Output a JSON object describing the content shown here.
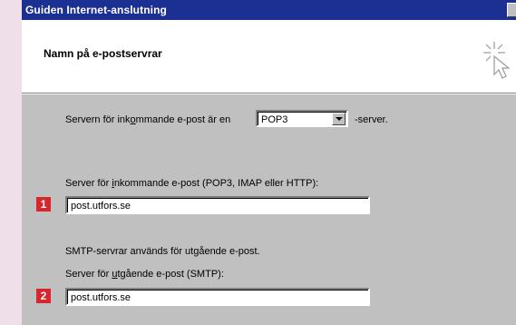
{
  "window": {
    "title": "Guiden Internet-anslutning"
  },
  "header": {
    "heading": "Namn på e-postservrar"
  },
  "incoming_type": {
    "label_before": "Servern för ink",
    "label_hotkey": "o",
    "label_after": "mmande e-post är en",
    "selected": "POP3",
    "suffix": "-server."
  },
  "incoming_server": {
    "label_before": "Server för ",
    "label_hotkey": "i",
    "label_after": "nkommande e-post (POP3, IMAP eller HTTP):",
    "value": "post.utfors.se",
    "badge": "1"
  },
  "smtp_info": "SMTP-servrar används för utgående e-post.",
  "outgoing_server": {
    "label_before": "Server för ",
    "label_hotkey": "u",
    "label_after": "tgående e-post (SMTP):",
    "value": "post.utfors.se",
    "badge": "2"
  },
  "colors": {
    "titlebar": "#1c2f93",
    "dialog_bg": "#c0c0c0",
    "badge": "#d8262d",
    "page_bg": "#efdfe8"
  }
}
